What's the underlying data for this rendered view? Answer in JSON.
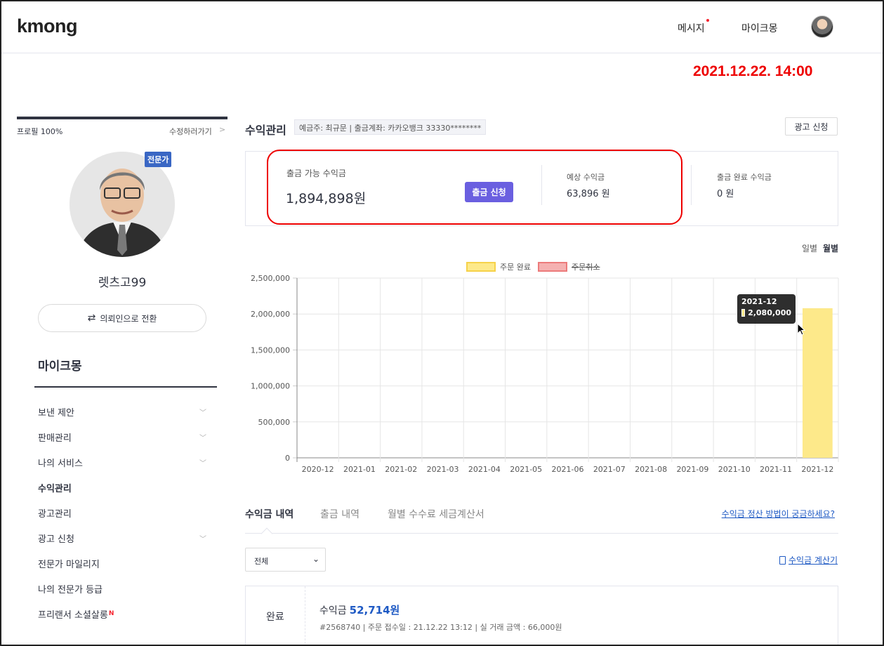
{
  "header": {
    "logo": "kmong",
    "messages": "메시지",
    "my_kmong": "마이크몽"
  },
  "timestamp": "2021.12.22. 14:00",
  "sidebar": {
    "profile_pct": "프로필 100%",
    "edit": "수정하러가기",
    "badge": "전문가",
    "name": "렛츠고99",
    "switch_label": "의뢰인으로 전환",
    "section_title": "마이크몽",
    "items": [
      {
        "label": "보낸 제안",
        "chevron": true
      },
      {
        "label": "판매관리",
        "chevron": true
      },
      {
        "label": "나의 서비스",
        "chevron": true
      },
      {
        "label": "수익관리",
        "active": true
      },
      {
        "label": "광고관리"
      },
      {
        "label": "광고 신청",
        "chevron": true
      },
      {
        "label": "전문가 마일리지"
      },
      {
        "label": "나의 전문가 등급"
      },
      {
        "label": "프리랜서 소셜살롱",
        "new": "N"
      }
    ]
  },
  "main": {
    "title": "수익관리",
    "account_info": "예금주: 최규문 | 출금계좌: 카카오뱅크 33330********",
    "ad_apply": "광고 신청",
    "withdrawable_label": "출금 가능 수익금",
    "withdrawable_amount": "1,894,898원",
    "withdraw_button": "출금 신청",
    "expected_label": "예상 수익금",
    "expected_value": "63,896 원",
    "completed_label": "출금 완료 수익금",
    "completed_value": "0 원",
    "period_daily": "일별",
    "period_monthly": "월별"
  },
  "chart_data": {
    "type": "bar",
    "categories": [
      "2020-12",
      "2021-01",
      "2021-02",
      "2021-03",
      "2021-04",
      "2021-05",
      "2021-06",
      "2021-07",
      "2021-08",
      "2021-09",
      "2021-10",
      "2021-11",
      "2021-12"
    ],
    "series": [
      {
        "name": "주문 완료",
        "values": [
          0,
          0,
          0,
          0,
          0,
          0,
          0,
          0,
          0,
          0,
          0,
          0,
          2080000
        ],
        "color": "#fde98a"
      },
      {
        "name": "주문취소",
        "values": [
          0,
          0,
          0,
          0,
          0,
          0,
          0,
          0,
          0,
          0,
          0,
          0,
          0
        ],
        "color": "#f5b1b1",
        "hidden": true
      }
    ],
    "yticks": [
      "0",
      "500,000",
      "1,000,000",
      "1,500,000",
      "2,000,000",
      "2,500,000"
    ],
    "ylim": [
      0,
      2500000
    ],
    "grid": true,
    "legend": "top-center",
    "tooltip": {
      "title": "2021-12",
      "value": "2,080,000"
    }
  },
  "tabs": {
    "items": [
      "수익금 내역",
      "출금 내역",
      "월별 수수료 세금계산서"
    ],
    "help": "수익금 정산 방법이 궁금하세요?"
  },
  "filter": {
    "selected": "전체"
  },
  "calc_link": "수익금 계산기",
  "records": [
    {
      "status": "완료",
      "label": "수익금",
      "amount": "52,714원",
      "meta": "#2568740 | 주문 접수일 : 21.12.22 13:12 | 실 거래 금액 : 66,000원"
    }
  ]
}
